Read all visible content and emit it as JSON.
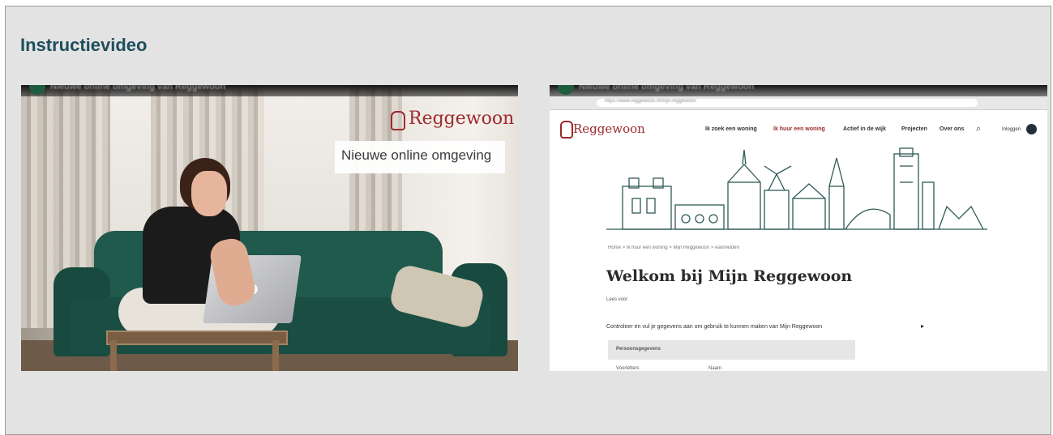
{
  "panel": {
    "title": "Instructievideo"
  },
  "videos": [
    {
      "top_bar_title": "Nieuwe online omgeving van Reggewoon",
      "brand": "Reggewoon",
      "caption": "Nieuwe online omgeving"
    },
    {
      "top_bar_title": "Nieuwe online omgeving van Reggewoon",
      "url": "https://www.reggewoon.nl/mijn-reggewoon",
      "site": {
        "logo": "Reggewoon",
        "nav": [
          "Ik zoek een woning",
          "Ik huur een woning",
          "Actief in de wijk",
          "Projecten",
          "Over ons"
        ],
        "login": "Inloggen",
        "breadcrumb": "Home  >  Ik huur een woning  >  Mijn Reggewoon  >  Aanmelden",
        "heading": "Welkom bij Mijn Reggewoon",
        "pill": "Lees voor",
        "intro": "Controleer en vul je gegevens aan om gebruik te kunnen maken van Mijn Reggewoon",
        "box_label": "Persoonsgegevens",
        "row_labels": [
          "Voorletters",
          "Naam"
        ]
      }
    }
  ],
  "colors": {
    "title": "#1f4e5c",
    "brand": "#9c2a2d",
    "sofa": "#1f5a4c"
  }
}
